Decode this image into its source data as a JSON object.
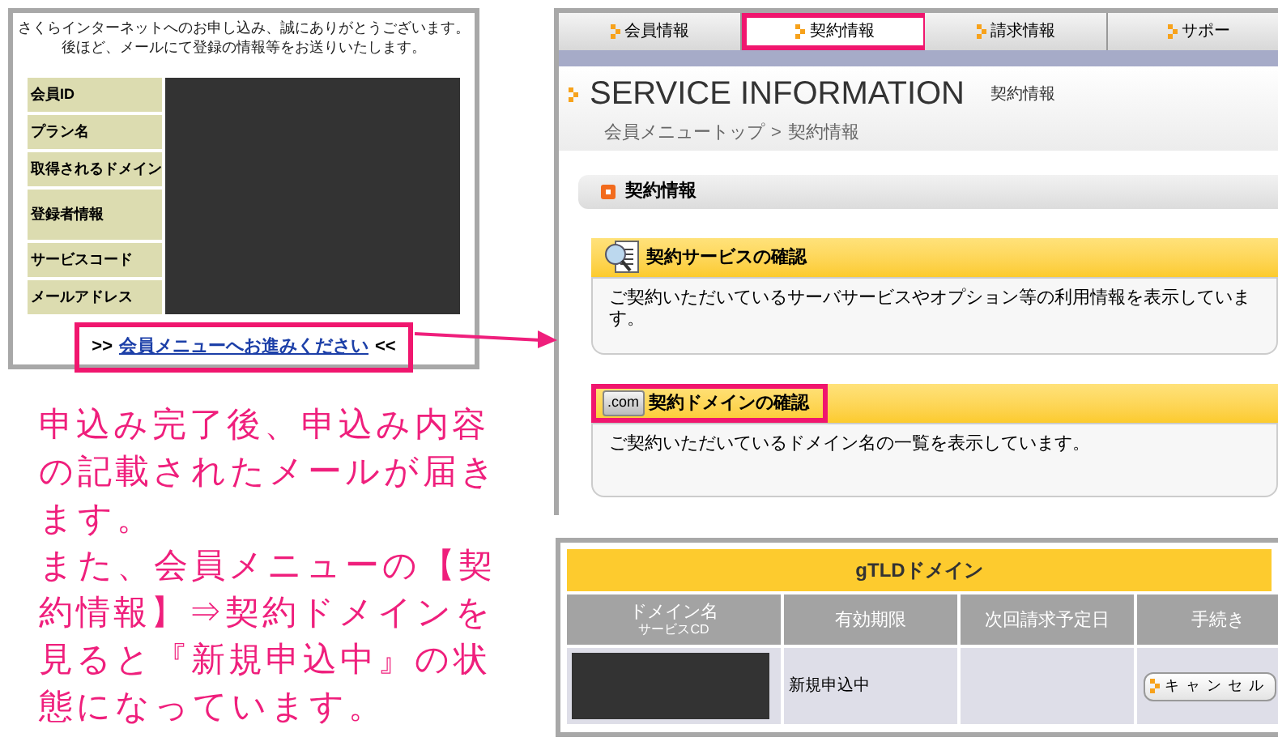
{
  "confirmation_panel": {
    "message": [
      "さくらインターネットへのお申し込み、誠にありがとうございます。",
      "後ほど、メールにて登録の情報等をお送りいたします。"
    ],
    "fields": [
      {
        "label": "会員ID",
        "tall": false
      },
      {
        "label": "プラン名",
        "tall": false
      },
      {
        "label": "取得されるドメイン",
        "tall": false
      },
      {
        "label": "登録者情報",
        "tall": true
      },
      {
        "label": "サービスコード",
        "tall": false
      },
      {
        "label": "メールアドレス",
        "tall": false
      }
    ],
    "link_prefix": ">>",
    "link": "会員メニューへお進みください",
    "link_suffix": "<<",
    "link_highlighted": true
  },
  "caption": [
    "申込み完了後、申込み内容の記載されたメールが届きます。",
    "また、会員メニューの【契約情報】⇒契約ドメインを見ると『新規申込中』の状態になっています。"
  ],
  "member_page": {
    "tabs": [
      {
        "label": "会員情報",
        "selected": false,
        "highlighted": false
      },
      {
        "label": "契約情報",
        "selected": true,
        "highlighted": true
      },
      {
        "label": "請求情報",
        "selected": false,
        "highlighted": false
      },
      {
        "label": "サポー",
        "selected": false,
        "highlighted": false
      }
    ],
    "title": "SERVICE INFORMATION",
    "subtitle": "契約情報",
    "breadcrumb": [
      "会員メニュートップ",
      "契約情報"
    ],
    "breadcrumb_separator": ">",
    "section": "契約情報",
    "cards": [
      {
        "kind": "service",
        "heading": "契約サービスの確認",
        "description": "ご契約いただいているサーバサービスやオプション等の利用情報を表示しています。",
        "highlighted": false
      },
      {
        "kind": "domain",
        "icon_text": ".com",
        "heading": "契約ドメインの確認",
        "description": "ご契約いただいているドメイン名の一覧を表示しています。",
        "highlighted": true
      }
    ]
  },
  "domain_table": {
    "title": "gTLDドメイン",
    "columns": [
      {
        "label": "ドメイン名",
        "sublabel": "サービスCD"
      },
      {
        "label": "有効期限"
      },
      {
        "label": "次回請求予定日"
      },
      {
        "label": "手続き"
      }
    ],
    "rows": [
      {
        "expiry": "新規申込中",
        "next_billing": "",
        "action": "キャンセル"
      }
    ]
  }
}
